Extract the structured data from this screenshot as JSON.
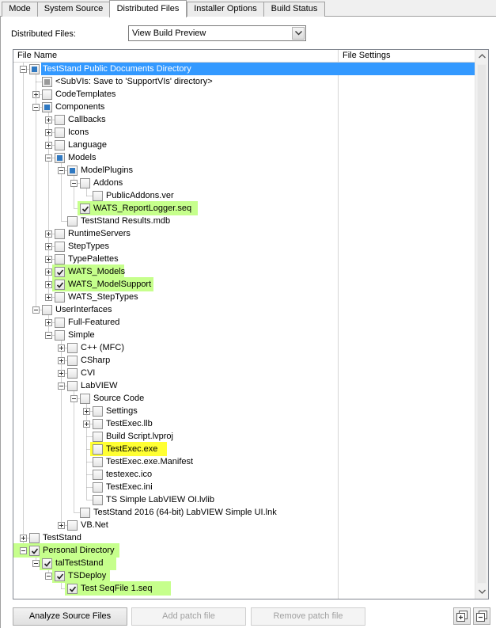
{
  "tabs": [
    {
      "label": "Mode"
    },
    {
      "label": "System Source"
    },
    {
      "label": "Distributed Files"
    },
    {
      "label": "Installer Options"
    },
    {
      "label": "Build Status"
    }
  ],
  "active_tab": "Distributed Files",
  "distributed_files": {
    "label": "Distributed Files:",
    "selected": "View Build Preview"
  },
  "tree": {
    "columns": [
      "File Name",
      "File Settings"
    ],
    "rows": [
      {
        "label": "TestStand Public Documents Directory",
        "depth": 0,
        "expander": "minus",
        "check": "partial",
        "selected": true
      },
      {
        "label": "<SubVIs: Save to 'SupportVIs' directory>",
        "depth": 1,
        "expander": "none",
        "check": "gray"
      },
      {
        "label": "CodeTemplates",
        "depth": 1,
        "expander": "plus",
        "check": "unchecked"
      },
      {
        "label": "Components",
        "depth": 1,
        "expander": "minus",
        "check": "partial"
      },
      {
        "label": "Callbacks",
        "depth": 2,
        "expander": "plus",
        "check": "unchecked"
      },
      {
        "label": "Icons",
        "depth": 2,
        "expander": "plus",
        "check": "unchecked"
      },
      {
        "label": "Language",
        "depth": 2,
        "expander": "plus",
        "check": "unchecked"
      },
      {
        "label": "Models",
        "depth": 2,
        "expander": "minus",
        "check": "partial"
      },
      {
        "label": "ModelPlugins",
        "depth": 3,
        "expander": "minus",
        "check": "partial"
      },
      {
        "label": "Addons",
        "depth": 4,
        "expander": "minus",
        "check": "unchecked"
      },
      {
        "label": "PublicAddons.ver",
        "depth": 5,
        "expander": "none",
        "check": "unchecked"
      },
      {
        "label": "WATS_ReportLogger.seq",
        "depth": 4,
        "expander": "none",
        "check": "checked",
        "highlight": "green"
      },
      {
        "label": "TestStand Results.mdb",
        "depth": 3,
        "expander": "none",
        "check": "unchecked"
      },
      {
        "label": "RuntimeServers",
        "depth": 2,
        "expander": "plus",
        "check": "unchecked"
      },
      {
        "label": "StepTypes",
        "depth": 2,
        "expander": "plus",
        "check": "unchecked"
      },
      {
        "label": "TypePalettes",
        "depth": 2,
        "expander": "plus",
        "check": "unchecked"
      },
      {
        "label": "WATS_Models",
        "depth": 2,
        "expander": "plus",
        "check": "checked",
        "highlight": "green"
      },
      {
        "label": "WATS_ModelSupport",
        "depth": 2,
        "expander": "plus",
        "check": "checked",
        "highlight": "green"
      },
      {
        "label": "WATS_StepTypes",
        "depth": 2,
        "expander": "plus",
        "check": "unchecked"
      },
      {
        "label": "UserInterfaces",
        "depth": 1,
        "expander": "minus",
        "check": "unchecked"
      },
      {
        "label": "Full-Featured",
        "depth": 2,
        "expander": "plus",
        "check": "unchecked"
      },
      {
        "label": "Simple",
        "depth": 2,
        "expander": "minus",
        "check": "unchecked"
      },
      {
        "label": "C++ (MFC)",
        "depth": 3,
        "expander": "plus",
        "check": "unchecked"
      },
      {
        "label": "CSharp",
        "depth": 3,
        "expander": "plus",
        "check": "unchecked"
      },
      {
        "label": "CVI",
        "depth": 3,
        "expander": "plus",
        "check": "unchecked"
      },
      {
        "label": "LabVIEW",
        "depth": 3,
        "expander": "minus",
        "check": "unchecked"
      },
      {
        "label": "Source Code",
        "depth": 4,
        "expander": "minus",
        "check": "unchecked"
      },
      {
        "label": "Settings",
        "depth": 5,
        "expander": "plus",
        "check": "unchecked"
      },
      {
        "label": "TestExec.llb",
        "depth": 5,
        "expander": "plus",
        "check": "unchecked"
      },
      {
        "label": "Build Script.lvproj",
        "depth": 5,
        "expander": "none",
        "check": "unchecked"
      },
      {
        "label": "TestExec.exe",
        "depth": 5,
        "expander": "none",
        "check": "unchecked",
        "highlight": "yellow"
      },
      {
        "label": "TestExec.exe.Manifest",
        "depth": 5,
        "expander": "none",
        "check": "unchecked"
      },
      {
        "label": "testexec.ico",
        "depth": 5,
        "expander": "none",
        "check": "unchecked"
      },
      {
        "label": "TestExec.ini",
        "depth": 5,
        "expander": "none",
        "check": "unchecked"
      },
      {
        "label": "TS Simple LabVIEW OI.lvlib",
        "depth": 5,
        "expander": "none",
        "check": "unchecked"
      },
      {
        "label": "TestStand 2016 (64-bit) LabVIEW Simple UI.lnk",
        "depth": 4,
        "expander": "none",
        "check": "unchecked"
      },
      {
        "label": "VB.Net",
        "depth": 3,
        "expander": "plus",
        "check": "unchecked"
      },
      {
        "label": "TestStand",
        "depth": 0,
        "expander": "plus",
        "check": "unchecked"
      },
      {
        "label": "Personal Directory",
        "depth": 0,
        "expander": "minus",
        "check": "checked",
        "highlight": "green"
      },
      {
        "label": "talTestStand",
        "depth": 1,
        "expander": "minus",
        "check": "checked",
        "highlight": "green"
      },
      {
        "label": "TSDeploy",
        "depth": 2,
        "expander": "minus",
        "check": "checked",
        "highlight": "green"
      },
      {
        "label": "Test SeqFile 1.seq",
        "depth": 3,
        "expander": "none",
        "check": "checked",
        "highlight": "green"
      }
    ]
  },
  "buttons": {
    "analyze": "Analyze Source Files",
    "add_patch": "Add patch file",
    "remove_patch": "Remove patch file"
  },
  "icons": [
    "expand-all-icon",
    "collapse-all-icon",
    "chevron-down-icon",
    "scroll-up-icon",
    "scroll-down-icon"
  ],
  "colors": {
    "selection": "#3399ff",
    "green_highlight": "#c6ff8c",
    "yellow_highlight": "#ffff33",
    "partial_check": "#2f79c2"
  }
}
